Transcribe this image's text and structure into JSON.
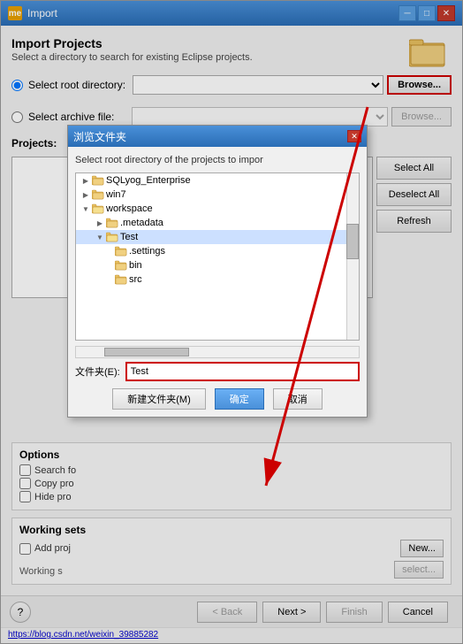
{
  "window": {
    "title": "Import",
    "icon": "me"
  },
  "header": {
    "title": "Import Projects",
    "description": "Select a directory to search for existing Eclipse projects."
  },
  "radio_root": {
    "label": "Select root directory:",
    "selected": true
  },
  "radio_archive": {
    "label": "Select archive file:"
  },
  "browse_btn1": {
    "label": "Browse..."
  },
  "browse_btn2": {
    "label": "Browse..."
  },
  "projects": {
    "label": "Projects:"
  },
  "sidebar_buttons": {
    "select_all": "Select All",
    "deselect_all": "Deselect All",
    "refresh": "Refresh"
  },
  "options": {
    "title": "Options",
    "search_for": "Search fo",
    "copy_proj": "Copy pro",
    "hide_proj": "Hide pro"
  },
  "working_sets": {
    "title": "Working sets",
    "add_proj": "Add proj",
    "working_status": "Working s",
    "new_btn": "New...",
    "select_btn": "select..."
  },
  "bottom_buttons": {
    "back": "< Back",
    "next": "Next >",
    "finish": "Finish",
    "cancel": "Cancel"
  },
  "status_bar": {
    "url": "https://blog.csdn.net/weixin_39885282"
  },
  "dialog": {
    "title": "浏览文件夹",
    "description": "Select root directory of the projects to impor",
    "close_btn": "✕",
    "tree_items": [
      {
        "indent": 0,
        "arrow": "▶",
        "label": "SQLyog_Enterprise",
        "folder": true,
        "level": 1
      },
      {
        "indent": 0,
        "arrow": "▶",
        "label": "win7",
        "folder": true,
        "level": 1
      },
      {
        "indent": 0,
        "arrow": "▼",
        "label": "workspace",
        "folder": true,
        "level": 1,
        "open": true
      },
      {
        "indent": 1,
        "arrow": "▶",
        "label": ".metadata",
        "folder": true,
        "level": 2
      },
      {
        "indent": 1,
        "arrow": "▼",
        "label": "Test",
        "folder": true,
        "level": 2,
        "open": true,
        "selected": true
      },
      {
        "indent": 2,
        "arrow": "",
        "label": ".settings",
        "folder": true,
        "level": 3
      },
      {
        "indent": 2,
        "arrow": "",
        "label": "bin",
        "folder": true,
        "level": 3
      },
      {
        "indent": 2,
        "arrow": "",
        "label": "src",
        "folder": true,
        "level": 3
      }
    ],
    "filename_label": "文件夹(E):",
    "filename_value": "Test",
    "btn_new_folder": "新建文件夹(M)",
    "btn_ok": "确定",
    "btn_cancel": "取消"
  }
}
